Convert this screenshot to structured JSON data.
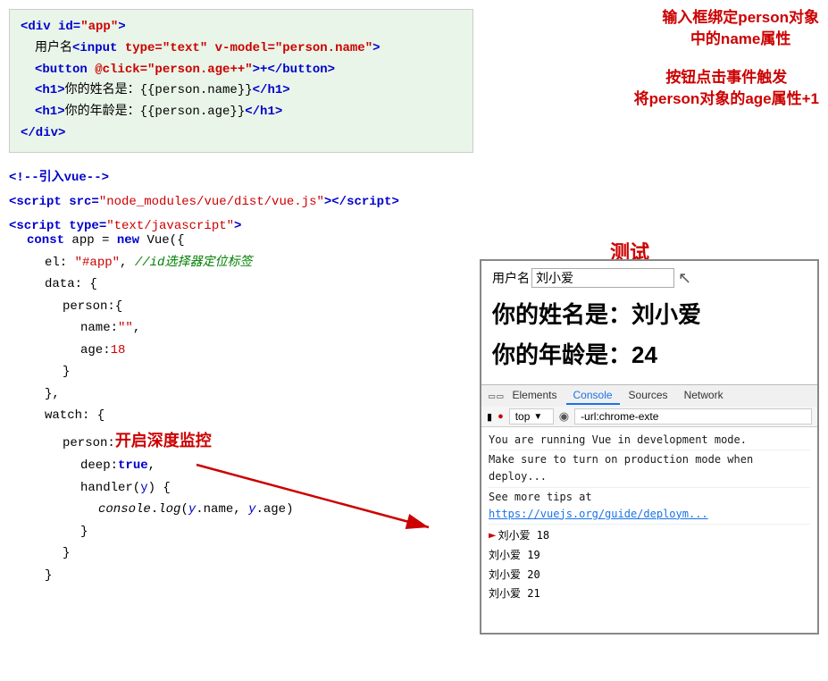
{
  "annotations": {
    "input_binding": "输入框绑定person对象\n中的name属性",
    "button_click": "按钮点击事件触发\n将person对象的age属性+1",
    "test_label": "测试",
    "deep_monitor": "开启深度监控"
  },
  "html_code": {
    "line1": "<div id=\"app\">",
    "line2_pre": "用户名",
    "line2_input": "<input type=\"text\" v-model=\"person.name\">",
    "line3_btn": "<button @click=\"person.age++\">+</button>",
    "line4": "<h1>你的姓名是：{{person.name}}</h1>",
    "line5": "<h1>你的年龄是：{{person.age}}</h1>",
    "line6": "</div>",
    "line7": "<!--引入vue-->",
    "line8": "<script src=\"node_modules/vue/dist/vue.js\"><\\/script>",
    "line9": "<script type=\"text/javascript\">"
  },
  "js_code": {
    "line1": "const app = new Vue({",
    "line2": "el: \"#app\",",
    "line2_comment": "//id选择器定位标签",
    "line3": "data: {",
    "line4": "person:{",
    "line5": "name:\"\",",
    "line6": "age:18",
    "line7": "}",
    "line8": "},",
    "line9": "watch: {",
    "line10": "person:{",
    "line11": "deep:true,",
    "line12": "handler(y) {",
    "line13": "console.log(y.name, y.age)",
    "line14": "}",
    "line15": "}",
    "line16": "}"
  },
  "preview": {
    "username_label": "用户名",
    "username_value": "刘小爱",
    "name_display": "你的姓名是：刘小爱",
    "age_display": "你的年龄是：24",
    "devtools_tabs": [
      "Elements",
      "Console",
      "Sources",
      "Network"
    ],
    "active_tab": "Console",
    "toolbar_top": "top",
    "console_line1": "You are running Vue in development mode.",
    "console_line2": "Make sure to turn on production mode when deploy...",
    "console_line3": "See more tips at https://vuejs.org/guide/deploym...",
    "console_outputs": [
      "刘小爱 18",
      "刘小爱 19",
      "刘小爱 20",
      "刘小爱 21"
    ],
    "highlighted_output": "刘小爱 18"
  }
}
